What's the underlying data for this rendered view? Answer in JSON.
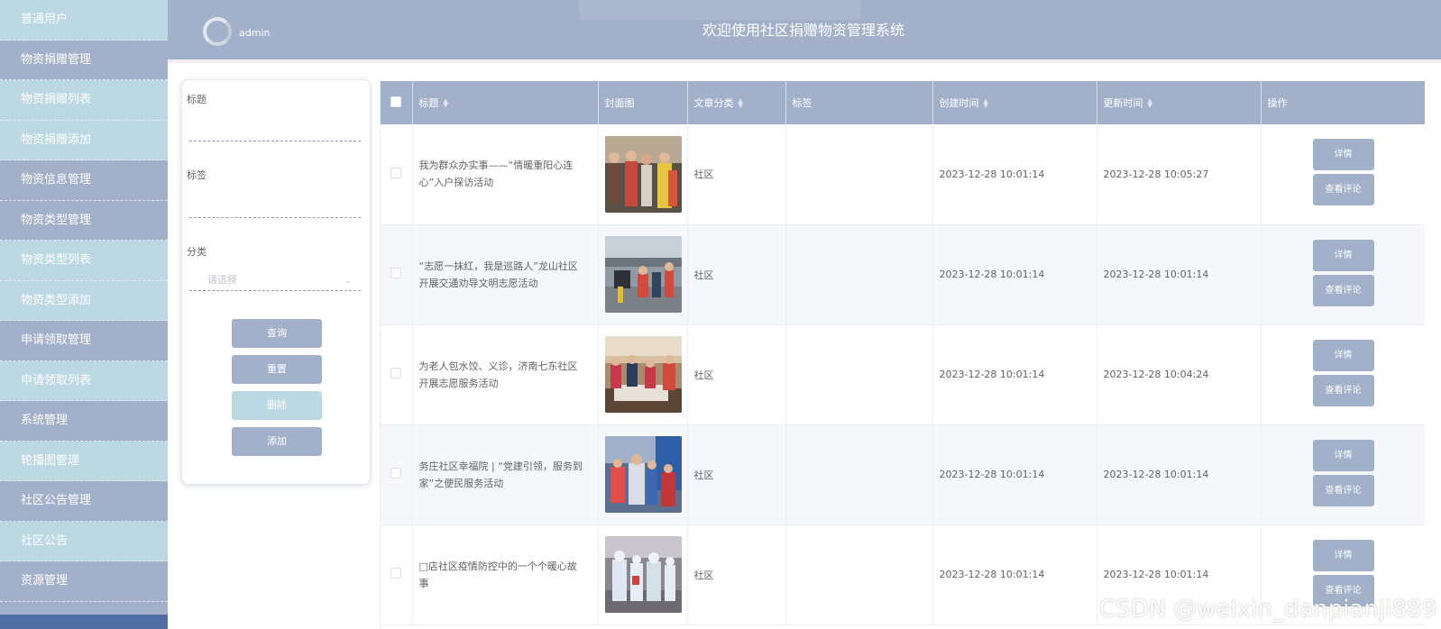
{
  "sidebar": {
    "items": [
      {
        "label": "普通用户",
        "kind": "sub"
      },
      {
        "label": "物资捐赠管理",
        "kind": "group"
      },
      {
        "label": "物资捐赠列表",
        "kind": "sub"
      },
      {
        "label": "物资捐赠添加",
        "kind": "sub"
      },
      {
        "label": "物资信息管理",
        "kind": "group"
      },
      {
        "label": "物资类型管理",
        "kind": "group"
      },
      {
        "label": "物资类型列表",
        "kind": "sub"
      },
      {
        "label": "物资类型添加",
        "kind": "sub"
      },
      {
        "label": "申请领取管理",
        "kind": "group"
      },
      {
        "label": "申请领取列表",
        "kind": "sub"
      },
      {
        "label": "系统管理",
        "kind": "group"
      },
      {
        "label": "轮播图管理",
        "kind": "sub"
      },
      {
        "label": "社区公告管理",
        "kind": "group"
      },
      {
        "label": "社区公告",
        "kind": "sub"
      },
      {
        "label": "资源管理",
        "kind": "group"
      }
    ]
  },
  "header": {
    "username": "admin",
    "title": "欢迎使用社区捐赠物资管理系统"
  },
  "search": {
    "title_label": "标题",
    "tag_label": "标签",
    "category_label": "分类",
    "category_placeholder": "请选择",
    "buttons": {
      "query": "查询",
      "reset": "重置",
      "delete": "删除",
      "add": "添加"
    }
  },
  "table": {
    "headers": {
      "title": "标题",
      "cover": "封面图",
      "category": "文章分类",
      "tags": "标签",
      "created": "创建时间",
      "updated": "更新时间",
      "actions": "操作"
    },
    "detail_label": "详情",
    "comment_label": "查看评论",
    "rows": [
      {
        "title": "我为群众办实事——“情暖重阳心连心”入户探访活动",
        "category": "社区",
        "tags": "",
        "created": "2023-12-28 10:01:14",
        "updated": "2023-12-28 10:05:27"
      },
      {
        "title": "“志愿一抹红，我是巡路人”龙山社区开展交通劝导文明志愿活动",
        "category": "社区",
        "tags": "",
        "created": "2023-12-28 10:01:14",
        "updated": "2023-12-28 10:01:14"
      },
      {
        "title": "为老人包水饺、义诊，济南七东社区开展志愿服务活动",
        "category": "社区",
        "tags": "",
        "created": "2023-12-28 10:01:14",
        "updated": "2023-12-28 10:04:24"
      },
      {
        "title": "务庄社区幸福院 | “党建引领，服务到家”之便民服务活动",
        "category": "社区",
        "tags": "",
        "created": "2023-12-28 10:01:14",
        "updated": "2023-12-28 10:01:14"
      },
      {
        "title": "□店社区疫情防控中的一个个暖心故事",
        "category": "社区",
        "tags": "",
        "created": "2023-12-28 10:01:14",
        "updated": "2023-12-28 10:01:14"
      }
    ]
  },
  "watermark": "CSDN @weixin_danpianji889"
}
